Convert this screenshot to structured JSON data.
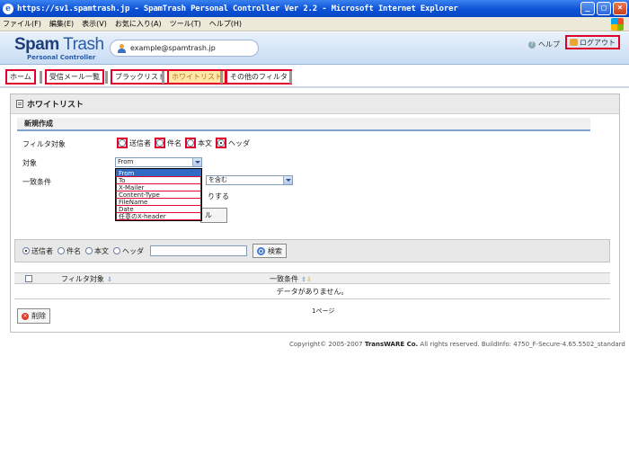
{
  "window": {
    "title": "https://sv1.spamtrash.jp - SpamTrash Personal Controller Ver 2.2 - Microsoft Internet Explorer",
    "minimize": "_",
    "maximize": "□",
    "close": "×"
  },
  "menubar": {
    "items": [
      "ファイル(F)",
      "編集(E)",
      "表示(V)",
      "お気に入り(A)",
      "ツール(T)",
      "ヘルプ(H)"
    ]
  },
  "header": {
    "logo_main_a": "Spam",
    "logo_main_b": " Trash",
    "logo_sub": "Personal Controller",
    "user_email": "example@spamtrash.jp",
    "help": "ヘルプ",
    "logout": "ログアウト"
  },
  "tabs": [
    "ホーム",
    "受信メール一覧",
    "ブラックリスト",
    "ホワイトリスト",
    "その他のフィルタ"
  ],
  "section": {
    "title": "ホワイトリスト",
    "subtitle": "新規作成"
  },
  "form": {
    "filter_target_label": "フィルタ対象",
    "target_label": "対象",
    "match_label": "一致条件",
    "radios": [
      {
        "label": "送信者",
        "checked": false
      },
      {
        "label": "件名",
        "checked": false
      },
      {
        "label": "本文",
        "checked": false
      },
      {
        "label": "ヘッダ",
        "checked": true
      }
    ],
    "target_value": "From",
    "match_value": "を含む",
    "behind_text": "りする",
    "behind_button": "ル",
    "dropdown_options": [
      "From",
      "To",
      "X-Mailer",
      "Content-Type",
      "FileName",
      "Date",
      "任意のX-header"
    ]
  },
  "search": {
    "radios": [
      {
        "label": "送信者",
        "checked": true
      },
      {
        "label": "件名",
        "checked": false
      },
      {
        "label": "本文",
        "checked": false
      },
      {
        "label": "ヘッダ",
        "checked": false
      }
    ],
    "input_value": "",
    "button": "検索"
  },
  "table": {
    "col_filter": "フィルタ対象",
    "col_match": "一致条件",
    "empty_message": "データがありません。",
    "pager": "1ページ",
    "delete_button": "削除"
  },
  "footer": {
    "copyright": "Copyright© 2005-2007 ",
    "company": "TransWARE Co.",
    "rest": " All rights reserved. BuildInfo: 4750_F-Secure-4.65.5502_standard"
  },
  "colors": {
    "highlight_red": "#e0002a",
    "titlebar_blue": "#0a4fd4",
    "active_tab_bg": "#ffe9a8",
    "selected_option": "#316ac5"
  }
}
